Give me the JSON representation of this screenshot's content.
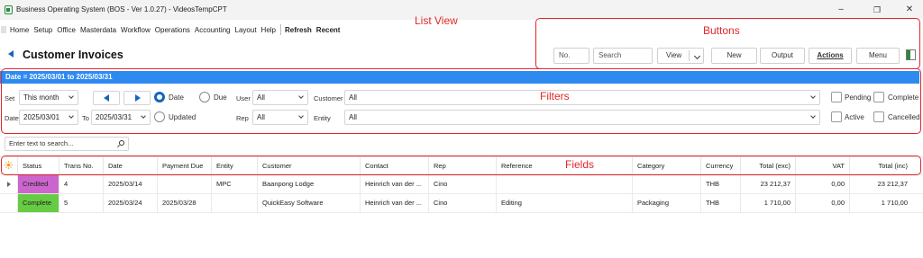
{
  "window": {
    "title": "Business Operating System (BOS - Ver 1.0.27) - VideosTempCPT",
    "icon": "app-icon",
    "controls": [
      "minimize-icon",
      "restore-icon",
      "close-icon"
    ]
  },
  "menu": {
    "items": [
      "Home",
      "Setup",
      "Office",
      "Masterdata",
      "Workflow",
      "Operations",
      "Accounting",
      "Layout",
      "Help"
    ],
    "refresh": "Refresh",
    "recent": "Recent"
  },
  "page": {
    "title": "Customer Invoices"
  },
  "toolbar": {
    "number_placeholder": "No.",
    "search_placeholder": "Search",
    "view_label": "View",
    "new_label": "New",
    "output_label": "Output",
    "actions_label": "Actions",
    "menu_label": "Menu"
  },
  "datebar": {
    "text": "Date = 2025/03/01 to 2025/03/31"
  },
  "filters": {
    "set_label": "Set",
    "set_value": "This month",
    "date_label": "Date",
    "date_from": "2025/03/01",
    "to_label": "To",
    "date_to": "2025/03/31",
    "radio_date": "Date",
    "radio_due": "Due",
    "radio_updated": "Updated",
    "user_label": "User",
    "user_value": "All",
    "rep_label": "Rep",
    "rep_value": "All",
    "customer_label": "Customer",
    "customer_value": "All",
    "entity_label": "Entity",
    "entity_value": "All",
    "pending": "Pending",
    "complete": "Complete",
    "active": "Active",
    "cancelled": "Cancelled"
  },
  "grid_search": {
    "placeholder": "Enter text to search..."
  },
  "grid": {
    "columns": [
      "Status",
      "Trans No.",
      "Date",
      "Payment Due",
      "Entity",
      "Customer",
      "Contact",
      "Rep",
      "Reference",
      "Category",
      "Currency",
      "Total (exc)",
      "VAT",
      "Total (inc)"
    ],
    "rows": [
      {
        "status": "Credited",
        "status_color": "#cc66cc",
        "trans_no": "4",
        "date": "2025/03/14",
        "payment_due": "",
        "entity": "MPC",
        "customer": "Baanpong Lodge",
        "contact": "Heinrich van der ...",
        "rep": "Cino",
        "reference": "",
        "category": "",
        "currency": "THB",
        "total_exc": "23 212,37",
        "vat": "0,00",
        "total_inc": "23 212,37"
      },
      {
        "status": "Complete",
        "status_color": "#66cc44",
        "trans_no": "5",
        "date": "2025/03/24",
        "payment_due": "2025/03/28",
        "entity": "",
        "customer": "QuickEasy Software",
        "contact": "Heinrich van der ...",
        "rep": "Cino",
        "reference": "Editing",
        "category": "Packaging",
        "currency": "THB",
        "total_exc": "1 710,00",
        "vat": "0,00",
        "total_inc": "1 710,00"
      }
    ]
  },
  "annotations": {
    "list_view": "List View",
    "buttons": "Buttons",
    "filters": "Filters",
    "fields": "Fields",
    "color": "#e0262a"
  }
}
